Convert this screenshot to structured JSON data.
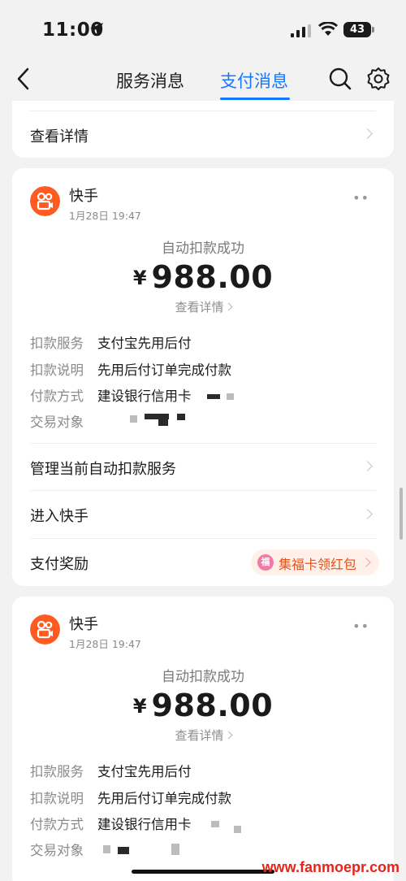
{
  "status_bar": {
    "time": "11:00",
    "battery": "43"
  },
  "nav": {
    "tabs": [
      {
        "label": "服务消息"
      },
      {
        "label": "支付消息"
      }
    ]
  },
  "top_card": {
    "row_label": "查看详情"
  },
  "cards": [
    {
      "app_name": "快手",
      "date": "1月28日 19:47",
      "status": "自动扣款成功",
      "currency": "¥",
      "amount": "988.00",
      "detail_link": "查看详情",
      "details": [
        {
          "key": "扣款服务",
          "value": "支付宝先用后付"
        },
        {
          "key": "扣款说明",
          "value": "先用后付订单完成付款"
        },
        {
          "key": "付款方式",
          "value": "建设银行信用卡"
        },
        {
          "key": "交易对象",
          "value": ""
        }
      ],
      "actions": [
        {
          "label": "管理当前自动扣款服务"
        },
        {
          "label": "进入快手"
        },
        {
          "label": "支付奖励"
        }
      ],
      "reward": {
        "badge": "福",
        "label": "集福卡领红包"
      }
    },
    {
      "app_name": "快手",
      "date": "1月28日 19:47",
      "status": "自动扣款成功",
      "currency": "¥",
      "amount": "988.00",
      "detail_link": "查看详情",
      "details": [
        {
          "key": "扣款服务",
          "value": "支付宝先用后付"
        },
        {
          "key": "扣款说明",
          "value": "先用后付订单完成付款"
        },
        {
          "key": "付款方式",
          "value": "建设银行信用卡"
        },
        {
          "key": "交易对象",
          "value": ""
        }
      ]
    }
  ],
  "watermark": "www.fanmoepr.com",
  "colors": {
    "accent": "#1677ff",
    "logo": "#ff5a1f",
    "reward_text": "#e0541f"
  },
  "icons": [
    "back-icon",
    "search-icon",
    "gear-icon",
    "location-arrow-icon",
    "signal-icon",
    "wifi-icon",
    "kuaishou-logo-icon",
    "chevron-right-icon",
    "more-icon"
  ]
}
